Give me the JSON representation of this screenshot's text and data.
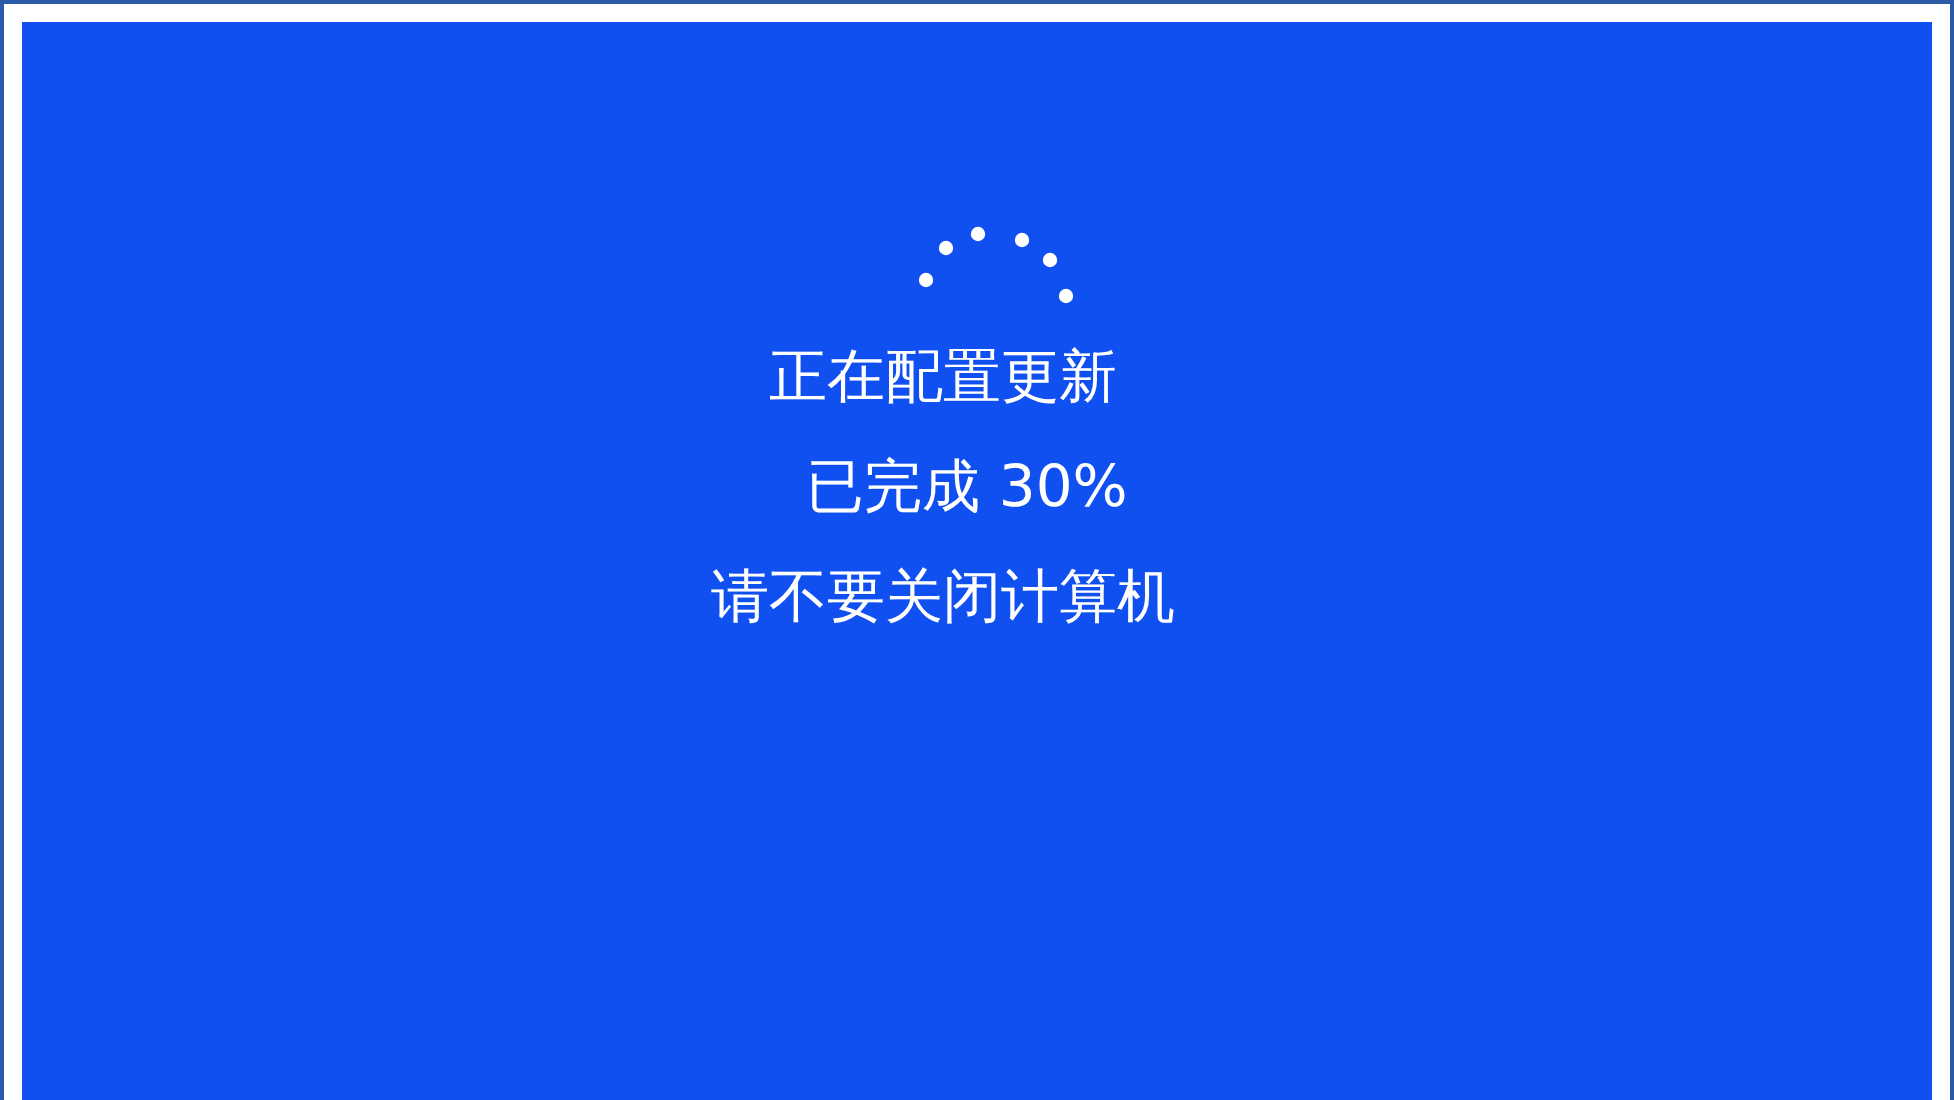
{
  "screen": {
    "lines": [
      "正在配置更新",
      "已完成 30%",
      "请不要关闭计算机"
    ]
  }
}
